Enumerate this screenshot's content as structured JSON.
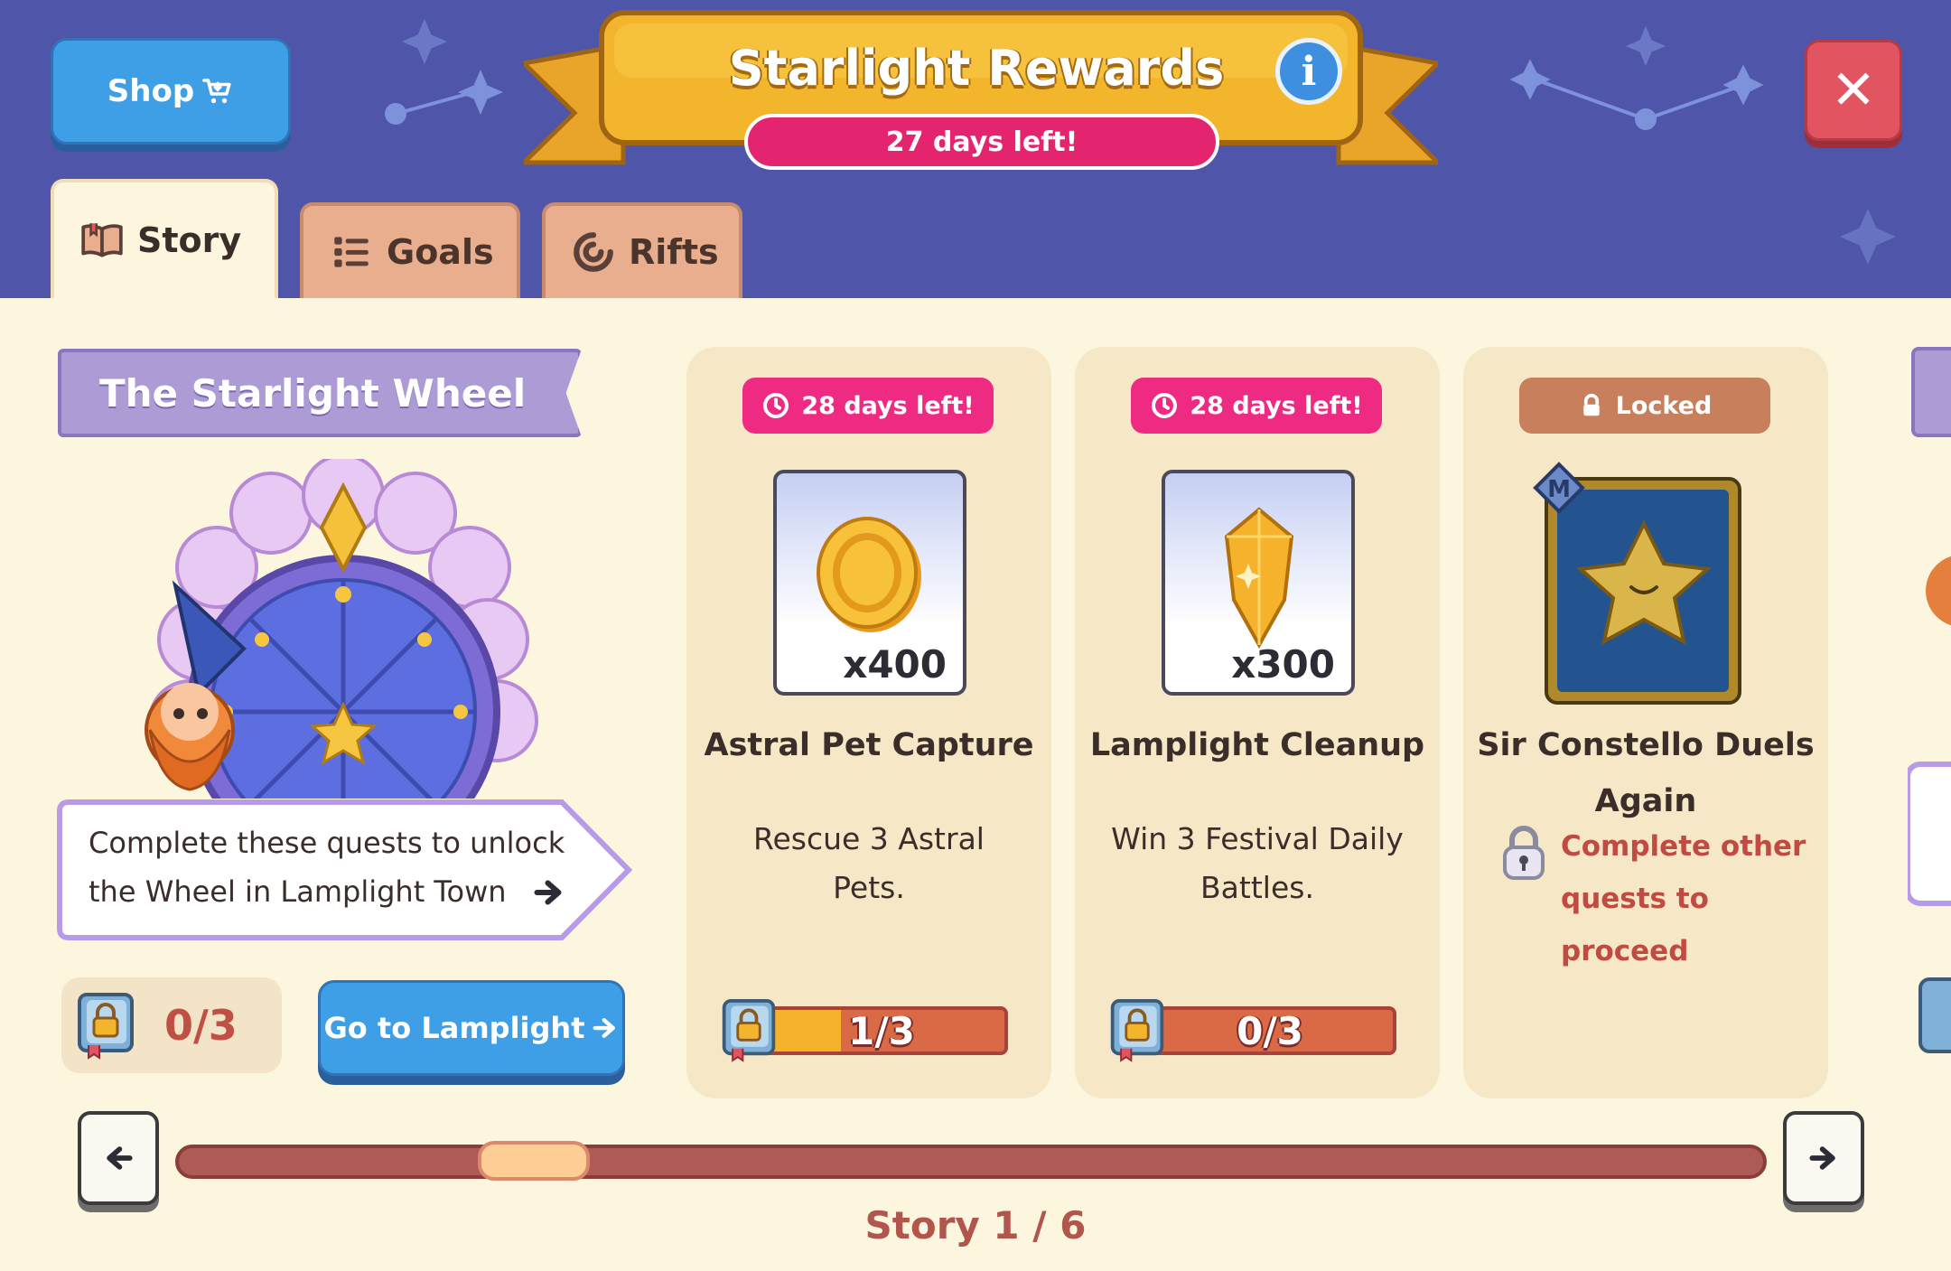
{
  "header": {
    "shop_label": "Shop",
    "title": "Starlight Rewards",
    "days_left": "27 days left!",
    "info_icon": "info-icon",
    "close_icon": "close-icon"
  },
  "tabs": [
    {
      "label": "Story",
      "icon": "book-icon",
      "active": true
    },
    {
      "label": "Goals",
      "icon": "list-icon",
      "active": false
    },
    {
      "label": "Rifts",
      "icon": "swirl-icon",
      "active": false
    }
  ],
  "story": {
    "title": "The Starlight Wheel",
    "description": "Complete these quests to unlock the Wheel in Lamplight Town",
    "progress": "0/3",
    "goto_label": "Go to Lamplight"
  },
  "quests": [
    {
      "badge": "28 days left!",
      "reward_qty": "x400",
      "reward_icon": "gold-coin-icon",
      "name": "Astral Pet Capture",
      "description": "Rescue 3 Astral Pets.",
      "progress_text": "1/3",
      "progress_fraction": 0.3333
    },
    {
      "badge": "28 days left!",
      "reward_qty": "x300",
      "reward_icon": "gold-crystal-icon",
      "name": "Lamplight Cleanup",
      "description": "Win 3 Festival Daily Battles.",
      "progress_text": "0/3",
      "progress_fraction": 0
    },
    {
      "badge": "Locked",
      "reward_icon": "star-monster-card-icon",
      "name": "Sir Constello Duels Again",
      "lock_message": "Complete other quests to proceed"
    }
  ],
  "pager": {
    "label": "Story 1 / 6",
    "position_fraction": 0.2
  },
  "colors": {
    "header_bg": "#4f55a8",
    "accent_blue": "#3f9fe6",
    "close_red": "#e25560",
    "timer_pink": "#ee2a82",
    "content_bg": "#fdf6df"
  }
}
